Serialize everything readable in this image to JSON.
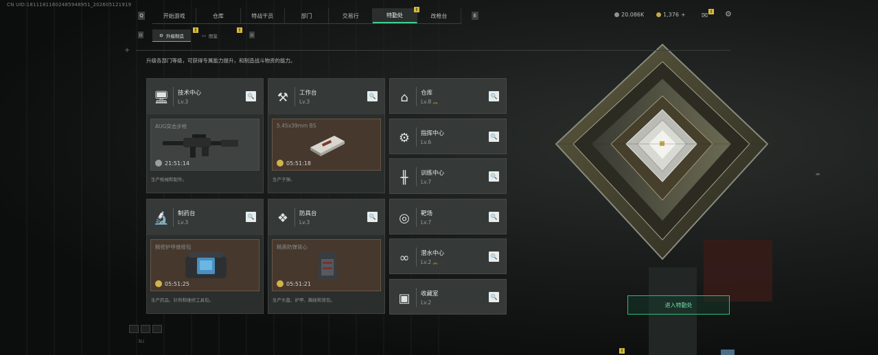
{
  "uid": "CN UID:18111811602485948951_202605121919",
  "nav": {
    "tabs": [
      "开始游戏",
      "仓库",
      "特战干员",
      "部门",
      "交易行",
      "特勤处",
      "改枪台"
    ],
    "active_index": 5,
    "active_badge": "!"
  },
  "subnav": {
    "tabs": [
      {
        "label": "升级制造",
        "badge": "!"
      },
      {
        "label": "图鉴",
        "badge": "!"
      }
    ]
  },
  "currency": {
    "silver": "20.086K",
    "gold": "1,376",
    "plus": "+",
    "mail_badge": "!"
  },
  "description": "升级各部门等级，可获得专属能力提升，和制造战斗物资的能力。",
  "workshops": [
    {
      "name": "技术中心",
      "level": "Lv.3",
      "icon": "monitor-icon",
      "product": "AUG突击步枪",
      "timer": "21:51:14",
      "desc": "生产枪械和配件。",
      "style": "grey"
    },
    {
      "name": "工作台",
      "level": "Lv.3",
      "icon": "tools-icon",
      "product": "5.45x39mm BS",
      "timer": "05:51:18",
      "desc": "生产子弹。",
      "style": "brown"
    },
    {
      "name": "制药台",
      "level": "Lv.3",
      "icon": "microscope-icon",
      "product": "精密护甲维修包",
      "timer": "05:51:25",
      "desc": "生产药品、针剂和维修工具包。",
      "style": "brown"
    },
    {
      "name": "防具台",
      "level": "Lv.3",
      "icon": "armor-parts-icon",
      "product": "精英防弹背心",
      "timer": "05:51:21",
      "desc": "生产头盔、护甲、胸挂和背包。",
      "style": "brown"
    }
  ],
  "departments": [
    {
      "name": "仓库",
      "level": "Lv.8",
      "icon": "warehouse-icon",
      "upgradable": true
    },
    {
      "name": "指挥中心",
      "level": "Lv.6",
      "icon": "chip-icon",
      "upgradable": false
    },
    {
      "name": "训练中心",
      "level": "Lv.7",
      "icon": "dumbbell-icon",
      "upgradable": false
    },
    {
      "name": "靶场",
      "level": "Lv.7",
      "icon": "target-icon",
      "upgradable": false
    },
    {
      "name": "潜水中心",
      "level": "Lv.2",
      "icon": "diving-mask-icon",
      "upgradable": true
    },
    {
      "name": "收藏室",
      "level": "Lv.2",
      "icon": "collection-icon",
      "upgradable": false
    }
  ],
  "enter_button": "进入特勤处",
  "version": "3LI",
  "colors": {
    "accent": "#3fd08e",
    "badge": "#d9b93b",
    "card_brown": "#46382d",
    "card_grey": "#3e4241"
  }
}
